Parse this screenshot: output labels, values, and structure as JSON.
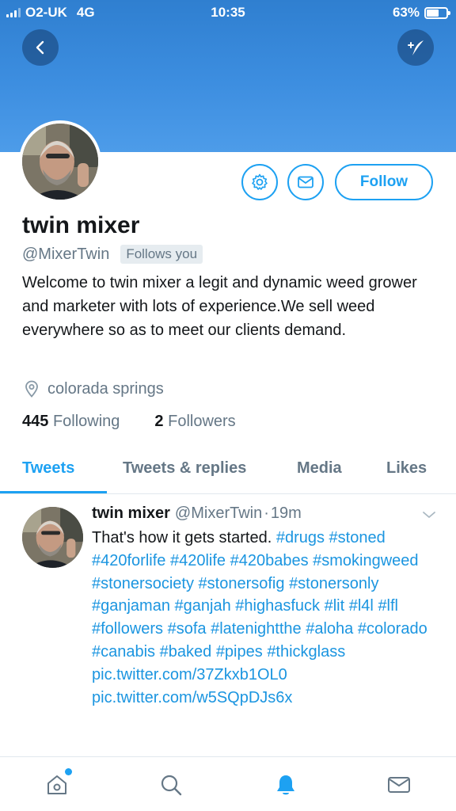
{
  "status_bar": {
    "carrier": "O2-UK",
    "network": "4G",
    "time": "10:35",
    "battery": "63%",
    "battery_level": 0.63
  },
  "header": {
    "back_icon": "chevron-left-icon",
    "compose_icon": "compose-feather-icon"
  },
  "profile": {
    "display_name": "twin mixer",
    "handle": "@MixerTwin",
    "follows_you": "Follows you",
    "bio": "Welcome to twin mixer a legit and dynamic weed grower and marketer with lots of experience.We sell weed everywhere so as to meet our clients demand.",
    "location": "colorada springs",
    "following_count": "445",
    "following_label": "Following",
    "followers_count": "2",
    "followers_label": "Followers",
    "follow_button": "Follow"
  },
  "tabs": [
    {
      "label": "Tweets",
      "active": true
    },
    {
      "label": "Tweets & replies",
      "active": false
    },
    {
      "label": "Media",
      "active": false
    },
    {
      "label": "Likes",
      "active": false
    }
  ],
  "tweet": {
    "name": "twin mixer",
    "handle": "@MixerTwin",
    "separator": "·",
    "time": "19m",
    "text": "That's how it gets started.",
    "hashtags": [
      "#drugs",
      "#stoned",
      "#420forlife",
      "#420life",
      "#420babes",
      "#smokingweed",
      "#stonersociety",
      "#stonersofig",
      "#stonersonly",
      "#ganjaman",
      "#ganjah",
      "#highasfuck",
      "#lit",
      "#l4l",
      "#lfl",
      "#followers",
      "#sofa",
      "#latenightthe",
      "#aloha",
      "#colorado",
      "#canabis",
      "#baked",
      "#pipes",
      "#thickglass"
    ],
    "links": [
      "pic.twitter.com/37Zkxb1OL0",
      "pic.twitter.com/w5SQpDJs6x"
    ]
  },
  "bottom_nav": [
    {
      "icon": "home-icon",
      "active": false,
      "badge": true
    },
    {
      "icon": "search-icon",
      "active": false
    },
    {
      "icon": "notifications-bell-icon",
      "active": true
    },
    {
      "icon": "messages-envelope-icon",
      "active": false
    }
  ],
  "colors": {
    "accent": "#1da1f2",
    "banner": "#3d8ee0",
    "secondary_text": "#657786"
  }
}
